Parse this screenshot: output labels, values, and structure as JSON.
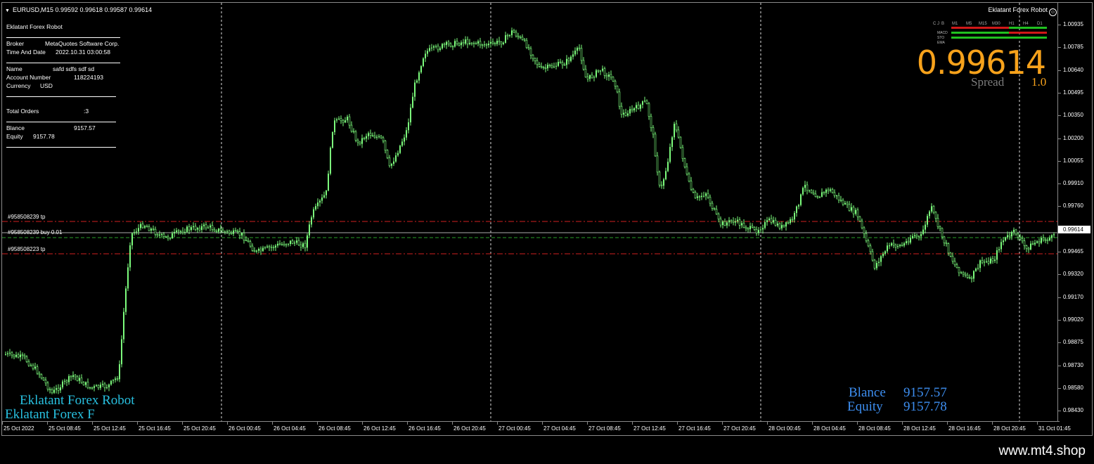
{
  "header": {
    "symbol_line": "EURUSD,M15  0.99592 0.99618 0.99587 0.99614",
    "robot_title": "Eklatant Forex Robot"
  },
  "info_panel": {
    "title": "Eklatant Forex Robot",
    "broker_label": "Broker",
    "broker_value": "MetaQuotes Software Corp.",
    "time_label": "Time And Date",
    "time_value": "2022.10.31 03:00:58",
    "name_label": "Name",
    "name_value": "safd    sdfs sdf  sd",
    "account_label": "Account Number",
    "account_value": "118224193",
    "currency_label": "Currency",
    "currency_value": "USD",
    "total_orders_label": "Total Orders",
    "total_orders_value": ":3",
    "balance_label": "Blance",
    "balance_value": "9157.57",
    "equity_label": "Equity",
    "equity_value": "9157.78"
  },
  "price_display": {
    "price": "0.99614",
    "spread_label": "Spread",
    "spread_value": "1.0",
    "price_color": "#f7a21b"
  },
  "mtf_panel": {
    "headers": [
      "C",
      "J",
      "B",
      "M1",
      "M5",
      "M15",
      "M30",
      "H1",
      "H4",
      "D1"
    ],
    "rows": [
      "MACD",
      "STO",
      "EMA"
    ]
  },
  "order_labels": [
    "#958508239 tp",
    "#958508239 buy 0.01",
    "#958508223 tp"
  ],
  "price_axis": {
    "labels": [
      "1.00935",
      "1.00785",
      "1.00640",
      "1.00495",
      "1.00350",
      "1.00200",
      "1.00055",
      "0.99910",
      "0.99760",
      "0.99614",
      "0.99465",
      "0.99320",
      "0.99170",
      "0.99020",
      "0.98875",
      "0.98730",
      "0.98580",
      "0.98430"
    ],
    "current_price": "0.99614"
  },
  "time_axis": {
    "labels": [
      "25 Oct 2022",
      "25 Oct 08:45",
      "25 Oct 12:45",
      "25 Oct 16:45",
      "25 Oct 20:45",
      "26 Oct 00:45",
      "26 Oct 04:45",
      "26 Oct 08:45",
      "26 Oct 12:45",
      "26 Oct 16:45",
      "26 Oct 20:45",
      "27 Oct 00:45",
      "27 Oct 04:45",
      "27 Oct 08:45",
      "27 Oct 12:45",
      "27 Oct 16:45",
      "27 Oct 20:45",
      "28 Oct 00:45",
      "28 Oct 04:45",
      "28 Oct 08:45",
      "28 Oct 12:45",
      "28 Oct 16:45",
      "28 Oct 20:45",
      "31 Oct 01:45"
    ]
  },
  "account_stats": {
    "balance_label": "Blance",
    "balance_value": "9157.57",
    "equity_label": "Equity",
    "equity_value": "9157.78"
  },
  "watermark": {
    "line1": "Eklatant Forex Robot",
    "line2": "Eklatant Forex F"
  },
  "footer": {
    "url": "www.mt4.shop"
  },
  "colors": {
    "candle": "#7CFC7C",
    "tp_line": "#d02020",
    "stats": "#3d8ef0",
    "watermark": "#28c0e0"
  }
}
